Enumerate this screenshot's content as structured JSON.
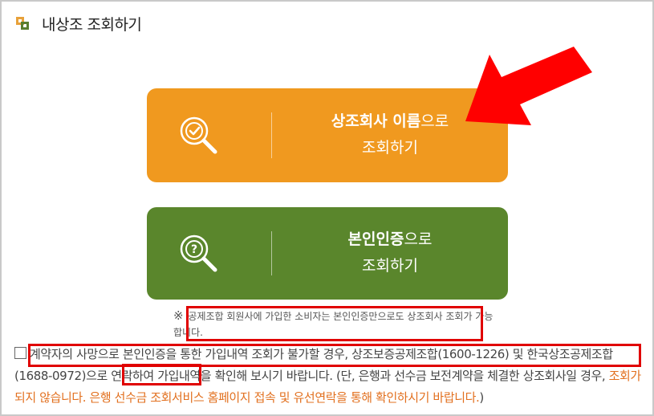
{
  "header": {
    "title": "내상조 조회하기"
  },
  "buttons": {
    "company": {
      "bold": "상조회사 이름",
      "rest": "으로",
      "line2": "조회하기",
      "color": "#f0991f"
    },
    "identity": {
      "bold": "본인인증",
      "rest": "으로",
      "line2": "조회하기",
      "color": "#5a862c"
    }
  },
  "note": {
    "mark": "※",
    "text": "공제조합 회원사에 가입한 소비자는 본인인증만으로도 상조회사 조회가 가능합니다."
  },
  "disclaimer": {
    "part1": "계약자의 사망으로 본인인증을 통한 가입내역 조회가 불가할 경우, 상조보증공제조합(1600-1226) 및 한국상조공제조합(1688-0972)으로 연락하여 가입내역을 확인해 보시기 바랍니다. (단, 은행과 선수금 보전계약을 체결한 상조회사일 경우, ",
    "orange": "조회가 되지 않습니다. 은행 선수금 조회서비스 홈페이지 접속 및 유선연락을 통해 확인하시기 바랍니다.",
    "part2": ")"
  },
  "colors": {
    "accent_red": "#e00000",
    "orange_text": "#e2701f"
  }
}
